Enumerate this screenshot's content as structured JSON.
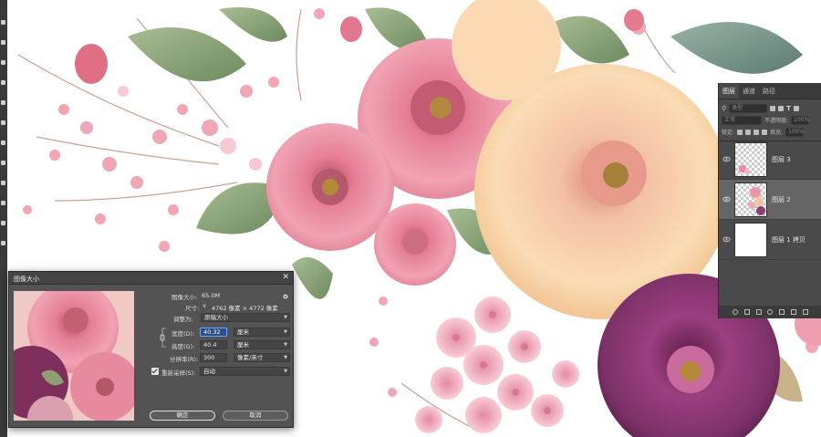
{
  "layers_panel": {
    "tabs": [
      "图层",
      "通道",
      "路径"
    ],
    "search_placeholder": "类型",
    "blend_mode": "正常",
    "opacity_label": "不透明度:",
    "opacity_value": "100%",
    "lock_label": "锁定:",
    "fill_label": "填充:",
    "fill_value": "100%",
    "layers": [
      {
        "name": "图层 3",
        "visible": true,
        "selected": false
      },
      {
        "name": "图层 2",
        "visible": true,
        "selected": true
      },
      {
        "name": "图层 1 拷贝",
        "visible": true,
        "selected": false
      }
    ]
  },
  "image_size_dialog": {
    "title": "图像大小",
    "image_size_label": "图像大小:",
    "image_size_value": "65.0M",
    "dimensions_label": "尺寸:",
    "dimensions_value": "4762 像素 × 4772 像素",
    "fit_to_label": "调整为:",
    "fit_to_value": "原稿大小",
    "width_label": "宽度(D):",
    "width_value": "40.32",
    "width_unit": "厘米",
    "height_label": "高度(G):",
    "height_value": "40.4",
    "height_unit": "厘米",
    "resolution_label": "分辨率(R):",
    "resolution_value": "300",
    "resolution_unit": "像素/英寸",
    "resample_label": "重新采样(S):",
    "resample_checked": true,
    "resample_value": "自动",
    "ok_label": "确定",
    "cancel_label": "取消"
  },
  "colors": {
    "panel_bg": "#535353",
    "focus_blue": "#2b4d8a"
  }
}
